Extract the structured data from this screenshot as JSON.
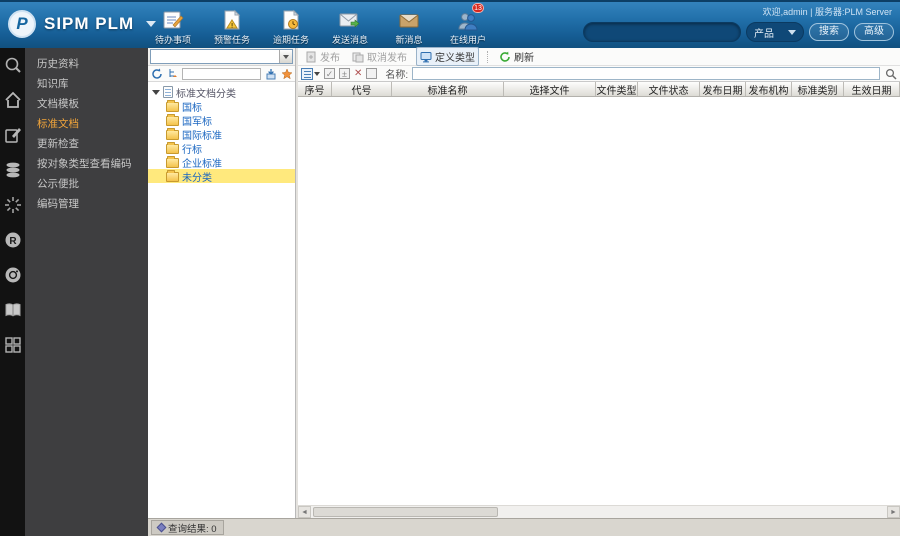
{
  "colors": {
    "header_blue": "#2271ab",
    "active_menu_orange": "#f2a53a",
    "tree_highlight_yellow": "#ffe97d",
    "badge_red": "#d8261c",
    "tree_link_blue": "#1a66c0"
  },
  "header": {
    "app_title": "SIPM PLM",
    "welcome_text": "欢迎,admin | 服务器:PLM Server",
    "tools": [
      {
        "label": "待办事项",
        "icon": "todo-icon"
      },
      {
        "label": "预警任务",
        "icon": "warning-task-icon"
      },
      {
        "label": "逾期任务",
        "icon": "overdue-task-icon"
      },
      {
        "label": "发送消息",
        "icon": "send-message-icon"
      },
      {
        "label": "新消息",
        "icon": "new-message-icon"
      },
      {
        "label": "在线用户",
        "icon": "online-users-icon",
        "badge": "13"
      }
    ],
    "search": {
      "input_value": "",
      "scope_value": "产品",
      "search_button": "搜索",
      "advanced_button": "高级"
    }
  },
  "sidebar": {
    "items": [
      {
        "label": "历史资料",
        "active": false
      },
      {
        "label": "知识库",
        "active": false
      },
      {
        "label": "文档模板",
        "active": false
      },
      {
        "label": "标准文档",
        "active": true
      },
      {
        "label": "更新检查",
        "active": false
      },
      {
        "label": "按对象类型查看编码",
        "active": false
      },
      {
        "label": "公示便批",
        "active": false
      },
      {
        "label": "编码管理",
        "active": false
      }
    ]
  },
  "tree_panel": {
    "combo_value": "",
    "root_label": "标准文档分类",
    "folders": [
      {
        "label": "国标",
        "selected": false
      },
      {
        "label": "国军标",
        "selected": false
      },
      {
        "label": "国际标准",
        "selected": false
      },
      {
        "label": "行标",
        "selected": false
      },
      {
        "label": "企业标准",
        "selected": false
      },
      {
        "label": "未分类",
        "selected": true
      }
    ]
  },
  "actions": {
    "publish": "发布",
    "unpublish": "取消发布",
    "define_type": "定义类型",
    "refresh": "刷新"
  },
  "filter": {
    "name_label": "名称:",
    "name_value": ""
  },
  "table": {
    "columns": [
      "序号",
      "代号",
      "标准名称",
      "选择文件",
      "文件类型",
      "文件状态",
      "发布日期",
      "发布机构",
      "标准类别",
      "生效日期"
    ],
    "rows": []
  },
  "statusbar": {
    "tab_label": "查询结果: 0"
  }
}
